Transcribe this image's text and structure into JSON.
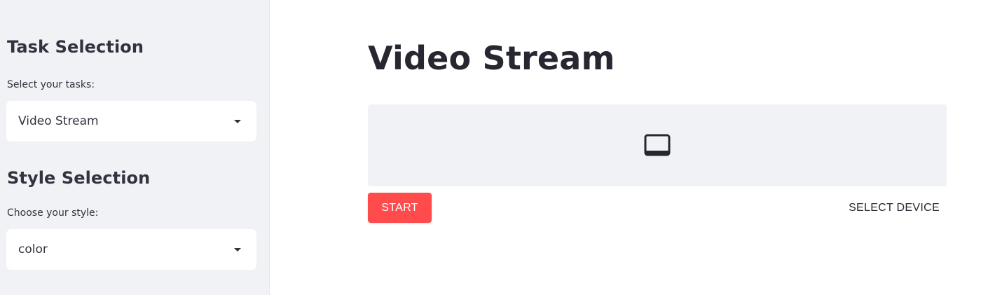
{
  "sidebar": {
    "task_section": {
      "heading": "Task Selection",
      "label": "Select your tasks:",
      "selected": "Video Stream"
    },
    "style_section": {
      "heading": "Style Selection",
      "label": "Choose your style:",
      "selected": "color"
    }
  },
  "main": {
    "title": "Video Stream",
    "video_placeholder_icon": "monitor-icon",
    "start_label": "START",
    "select_device_label": "SELECT DEVICE"
  },
  "colors": {
    "sidebar_bg": "#f0f2f6",
    "primary": "#ff4b4b",
    "text": "#31333f"
  }
}
